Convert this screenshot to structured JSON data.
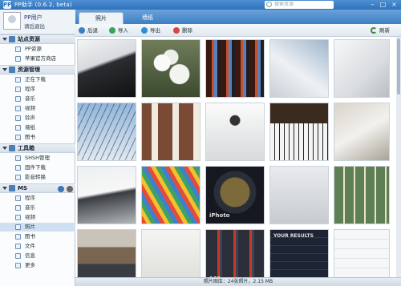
{
  "window": {
    "icon_text": "PP",
    "title": "PP助手 (0.6.2, beta)",
    "search_placeholder": "搜索资源",
    "minimize": "–",
    "maximize": "□",
    "close": "×"
  },
  "user": {
    "name": "PP用户",
    "logout": "请后退出"
  },
  "sidebar": {
    "sections": [
      {
        "label": "站点资源",
        "items": [
          "PP资源",
          "苹果官方商店"
        ]
      },
      {
        "label": "资源管理",
        "items": [
          "正在下载",
          "程序",
          "音乐",
          "视频",
          "铃声",
          "墙纸",
          "图书"
        ]
      },
      {
        "label": "工具箱",
        "items": [
          "SHSH管理",
          "固件下载",
          "影音转换"
        ]
      },
      {
        "label": "MS",
        "items": [
          "程序",
          "音乐",
          "视频",
          "照片",
          "图书",
          "文件",
          "信息",
          "更多"
        ]
      }
    ],
    "selected": "照片"
  },
  "tabs": [
    {
      "label": "照片",
      "active": true
    },
    {
      "label": "墙纸",
      "active": false
    }
  ],
  "toolbar": {
    "back": "后退",
    "import": "导入",
    "export": "导出",
    "delete": "删除",
    "refresh": "刷新"
  },
  "photos": [
    {
      "subject": "ipad-screen-dark"
    },
    {
      "subject": "white-flowers"
    },
    {
      "subject": "ipad-home-screen"
    },
    {
      "subject": "iphone-app-icons"
    },
    {
      "subject": "ipad-back-apple-logo"
    },
    {
      "subject": "bare-tree-sky"
    },
    {
      "subject": "brick-building"
    },
    {
      "subject": "apple-logo-white"
    },
    {
      "subject": "piano-app"
    },
    {
      "subject": "ipad-edge"
    },
    {
      "subject": "ipad-on-table"
    },
    {
      "subject": "color-swatches"
    },
    {
      "subject": "iphoto-app-icon"
    },
    {
      "subject": "white-ipad"
    },
    {
      "subject": "settings-screen"
    },
    {
      "subject": "person-with-ipad"
    },
    {
      "subject": "white-device"
    },
    {
      "subject": "gmail-icon-101"
    },
    {
      "subject": "your-results-app"
    },
    {
      "subject": "settings-list"
    }
  ],
  "photo_overlays": {
    "iphoto_label": "iPhoto",
    "results_label": "YOUR RESULTS",
    "gmail_badge": "101"
  },
  "status": {
    "text": "照片图库：24张照片，2.15 MB"
  },
  "colors": {
    "accent": "#2f72ba",
    "selection": "#cfe0f3",
    "tab_active": "#eef3f8"
  }
}
